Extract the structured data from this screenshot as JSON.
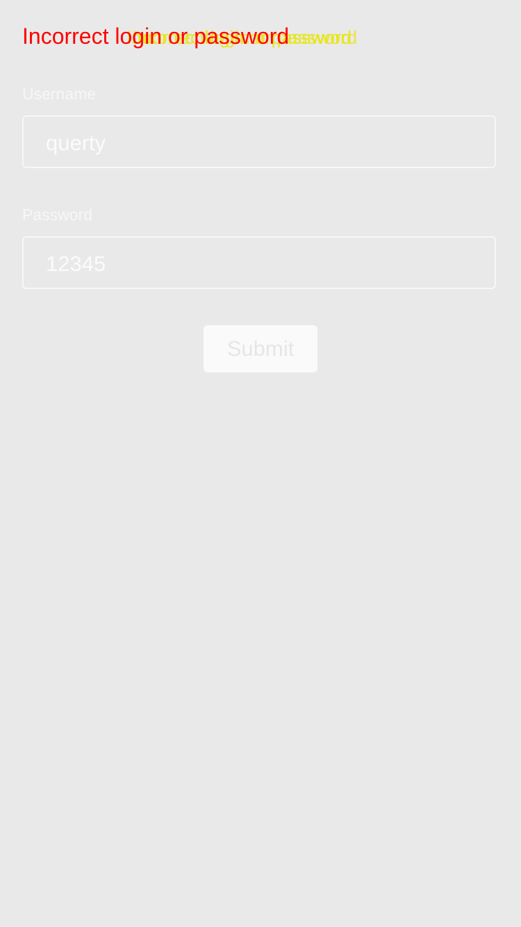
{
  "error": {
    "message": "Incorrect login or password",
    "overlay_text_1": "Incorrect login or password",
    "overlay_text_2": "Incorrect login or password"
  },
  "form": {
    "username": {
      "label": "Username",
      "value": "querty"
    },
    "password": {
      "label": "Password",
      "value": "12345"
    },
    "submit_label": "Submit"
  },
  "colors": {
    "background": "#e9e9e9",
    "error": "#ff0000",
    "overlay": "#e6e600",
    "field_border": "#f7f7f7"
  }
}
